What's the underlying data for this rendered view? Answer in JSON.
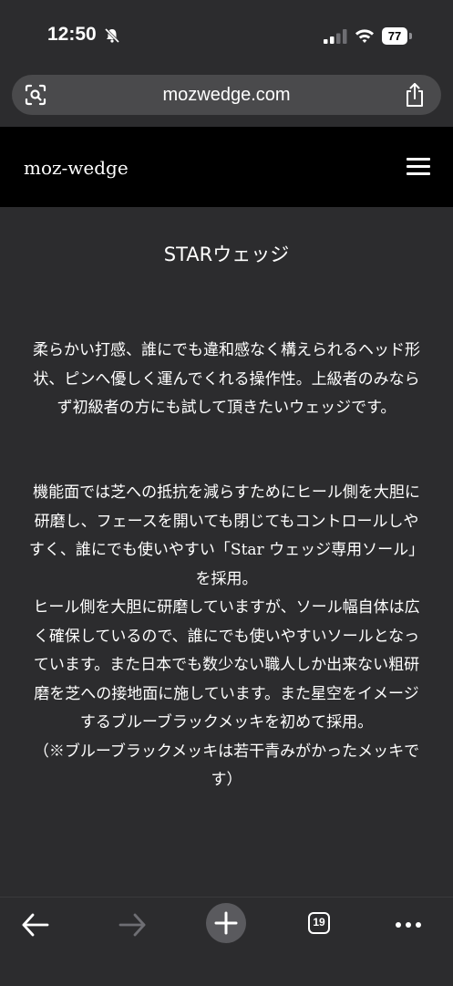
{
  "status_bar": {
    "time": "12:50",
    "battery": "77",
    "icons": [
      "bell-muted-icon",
      "cell-signal-icon",
      "wifi-icon",
      "battery-icon"
    ]
  },
  "browser": {
    "url": "mozwedge.com",
    "icons": [
      "scan-icon",
      "share-icon"
    ]
  },
  "site_header": {
    "title": "moz-wedge",
    "menu_icon": "hamburger-menu-icon"
  },
  "content": {
    "product_title": "STARウェッジ",
    "paragraph_1": "柔らかい打感、誰にでも違和感なく構えられるヘッド形状、ピンへ優しく運んでくれる操作性。上級者のみならず初級者の方にも試して頂きたいウェッジです。",
    "paragraph_2": "機能面では芝への抵抗を減らすためにヒール側を大胆に研磨し、フェースを開いても閉じてもコントロールしやすく、誰にでも使いやすい「Star ウェッジ専用ソール」を採用。\nヒール側を大胆に研磨していますが、ソール幅自体は広く確保しているので、誰にでも使いやすいソールとなっています。また日本でも数少ない職人しか出来ない粗研磨を芝への接地面に施しています。また星空をイメージするブルーブラックメッキを初めて採用。\n（※ブルーブラックメッキは若干青みがかったメッキです）"
  },
  "toolbar": {
    "tab_count": "19",
    "icons": [
      "back-arrow-icon",
      "forward-arrow-icon",
      "plus-icon",
      "tabs-icon",
      "more-dots-icon"
    ]
  },
  "colors": {
    "background": "#2c2c2e",
    "header": "#000000",
    "url_bar": "#4a4a4c",
    "disabled": "#8e8e93"
  }
}
